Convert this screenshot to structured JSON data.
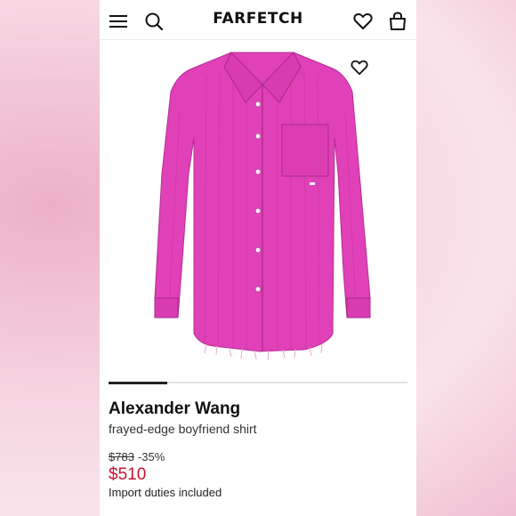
{
  "header": {
    "logo": "FARFETCH",
    "menu_icon": "hamburger-menu-icon",
    "search_icon": "search-icon",
    "wishlist_icon": "heart-icon",
    "bag_icon": "shopping-bag-icon"
  },
  "product": {
    "brand": "Alexander Wang",
    "name": "frayed-edge boyfriend shirt",
    "original_price": "$783",
    "discount": "-35%",
    "sale_price": "$510",
    "duties_note": "Import duties included",
    "image_color": "#e040b8"
  },
  "colors": {
    "accent_price": "#c8102e",
    "background_pink": "#f3c5d6"
  }
}
